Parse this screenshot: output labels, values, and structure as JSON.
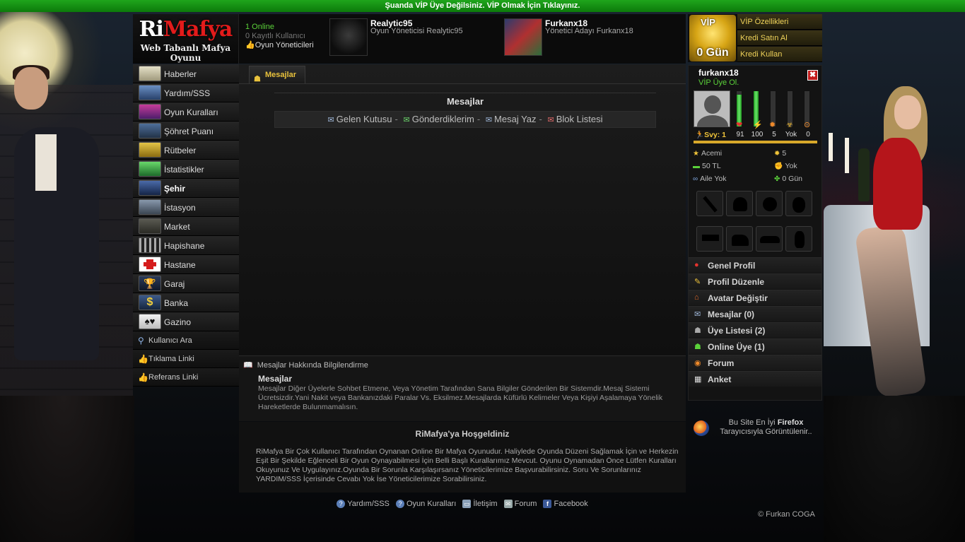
{
  "vip_bar": "Şuanda VİP Üye Değilsiniz. VİP Olmak İçin Tıklayınız.",
  "logo": {
    "part1": "Ri",
    "part2": "Mafya",
    "subtitle": "Web Tabanlı Mafya Oyunu"
  },
  "header": {
    "online": "1 Online",
    "registered": "0 Kayıtlı Kullanıcı",
    "admins_link": "Oyun Yöneticileri",
    "staff": [
      {
        "name": "Realytic95",
        "role": "Oyun Yöneticisi Realytic95"
      },
      {
        "name": "Furkanx18",
        "role": "Yönetici Adayı Furkanx18"
      }
    ]
  },
  "nav": [
    {
      "label": "Haberler",
      "icon": "newspaper-icon"
    },
    {
      "label": "Yardım/SSS",
      "icon": "help-icon"
    },
    {
      "label": "Oyun Kuralları",
      "icon": "rules-icon"
    },
    {
      "label": "Şöhret Puanı",
      "icon": "fame-icon"
    },
    {
      "label": "Rütbeler",
      "icon": "rank-icon"
    },
    {
      "label": "İstatistikler",
      "icon": "stats-icon"
    },
    {
      "label": "Şehir",
      "icon": "city-icon",
      "bold": true
    },
    {
      "label": "İstasyon",
      "icon": "station-icon"
    },
    {
      "label": "Market",
      "icon": "market-icon"
    },
    {
      "label": "Hapishane",
      "icon": "jail-icon"
    },
    {
      "label": "Hastane",
      "icon": "hospital-icon"
    },
    {
      "label": "Garaj",
      "icon": "trophy-icon"
    },
    {
      "label": "Banka",
      "icon": "dollar-icon"
    },
    {
      "label": "Gazino",
      "icon": "cards-icon"
    }
  ],
  "nav_small": [
    {
      "label": "Kullanıcı Ara",
      "icon": "search-icon"
    },
    {
      "label": "Tıklama Linki",
      "icon": "thumbs-up-icon"
    },
    {
      "label": "Referans Linki",
      "icon": "thumbs-up-icon"
    }
  ],
  "tab": {
    "label": "Mesajlar"
  },
  "messages": {
    "title": "Mesajlar",
    "links": [
      "Gelen Kutusu",
      "Gönderdiklerim",
      "Mesaj Yaz",
      "Blok Listesi"
    ],
    "separator": "-"
  },
  "info": {
    "heading": "Mesajlar Hakkında Bilgilendirme",
    "title": "Mesajlar",
    "text": "Mesajlar Diğer Üyelerle Sohbet Etmene, Veya Yönetim Tarafından Sana Bilgiler Gönderilen Bir Sistemdir.Mesaj Sistemi Ücretsizdir.Yani Nakit veya Bankanızdaki Paralar Vs. Eksilmez.Mesajlarda Küfürlü Kelimeler Veya Kişiyi Aşalamaya Yönelik Hareketlerde Bulunmamalısın."
  },
  "welcome": {
    "title": "RiMafya'ya Hoşgeldiniz",
    "text": "RiMafya Bir Çok Kullanıcı Tarafından Oynanan Online Bir Mafya Oyunudur. Haliylede Oyunda Düzeni Sağlamak İçin ve Herkezin Eşit Bir Şekilde Eğlenceli Bir Oyun Oynayabilmesi İçin Belli Başlı Kurallarımız Mevcut. Oyunu Oynamadan Önce Lütfen Kuralları Okuyunuz Ve Uygulayınız.Oyunda Bir Sorunla Karşılaşırsanız Yöneticilerimize Başvurabilirsiniz. Soru Ve Sorunlarınız YARDIM/SSS İçerisinde Cevabı Yok İse Yöneticilerimize Sorabilirsiniz."
  },
  "footer": {
    "links": [
      "Yardım/SSS",
      "Oyun Kuralları",
      "İletişim",
      "Forum",
      "Facebook"
    ],
    "copyright": "© Furkan COGA"
  },
  "vip_box": {
    "badge": "VİP",
    "days": "0 Gün",
    "links": [
      "VİP Özellikleri",
      "Kredi Satın Al",
      "Kredi Kullan"
    ]
  },
  "profile": {
    "username": "furkanx18",
    "vip_status": "VİP Üye Ol.",
    "close": "✖",
    "level_label": "Svy: 1",
    "level_progress": 1.0,
    "bars": [
      {
        "name": "health",
        "value": "91",
        "fill": 0.91,
        "icon": "heart-icon",
        "glyph": "❤",
        "color": "#e3332e"
      },
      {
        "name": "energy",
        "value": "100",
        "fill": 1.0,
        "icon": "lightning-icon",
        "glyph": "⚡",
        "color": "#f0c43a"
      },
      {
        "name": "bullets",
        "value": "5",
        "fill": 0.0,
        "icon": "burst-icon",
        "glyph": "✹",
        "color": "#f08a2a"
      },
      {
        "name": "toxic",
        "value": "Yok",
        "fill": 0.0,
        "icon": "biohazard-icon",
        "glyph": "☣",
        "color": "#e8b431"
      },
      {
        "name": "search",
        "value": "0",
        "fill": 0.0,
        "icon": "magnifier-icon",
        "glyph": "⊙",
        "color": "#f08a2a"
      }
    ],
    "stats": [
      {
        "label": "Acemi",
        "icon": "star-icon",
        "glyph": "★",
        "color": "#f0c43a"
      },
      {
        "label": "5",
        "icon": "sun-icon",
        "glyph": "✹",
        "color": "#f0c43a"
      },
      {
        "label": "50 TL",
        "icon": "money-icon",
        "glyph": "▬",
        "color": "#5bd23a"
      },
      {
        "label": "Yok",
        "icon": "fist-icon",
        "glyph": "✊",
        "color": "#e6a35a"
      },
      {
        "label": "Aile Yok",
        "icon": "family-icon",
        "glyph": "∞",
        "color": "#7fa7e0"
      },
      {
        "label": "0 Gün",
        "icon": "clover-icon",
        "glyph": "✤",
        "color": "#5bd23a"
      }
    ],
    "slots": [
      "knife-slot",
      "helmet-slot",
      "bomb-slot",
      "grenade-slot",
      "pistol-slot",
      "dog-slot",
      "car-slot",
      "vase-slot"
    ],
    "menu": [
      {
        "label": "Genel Profil",
        "icon": "profile-icon",
        "glyph": "●",
        "color": "#e3332e"
      },
      {
        "label": "Profil Düzenle",
        "icon": "edit-icon",
        "glyph": "✎",
        "color": "#f0c43a"
      },
      {
        "label": "Avatar Değiştir",
        "icon": "avatar-icon",
        "glyph": "⌂",
        "color": "#e36a2a"
      },
      {
        "label": "Mesajlar (0)",
        "icon": "envelope-icon",
        "glyph": "✉",
        "color": "#9fb7d9"
      },
      {
        "label": "Üye Listesi (2)",
        "icon": "users-icon",
        "glyph": "☗",
        "color": "#aaa"
      },
      {
        "label": "Online Üye (1)",
        "icon": "online-users-icon",
        "glyph": "☗",
        "color": "#5bd23a"
      },
      {
        "label": "Forum",
        "icon": "forum-icon",
        "glyph": "◉",
        "color": "#f08a2a"
      },
      {
        "label": "Anket",
        "icon": "poll-icon",
        "glyph": "▦",
        "color": "#ddd"
      }
    ]
  },
  "firefox": {
    "line1_prefix": "Bu Site En İyi",
    "line1_bold": "Firefox",
    "line2": "Tarayıcısıyla Görüntülenir.."
  }
}
